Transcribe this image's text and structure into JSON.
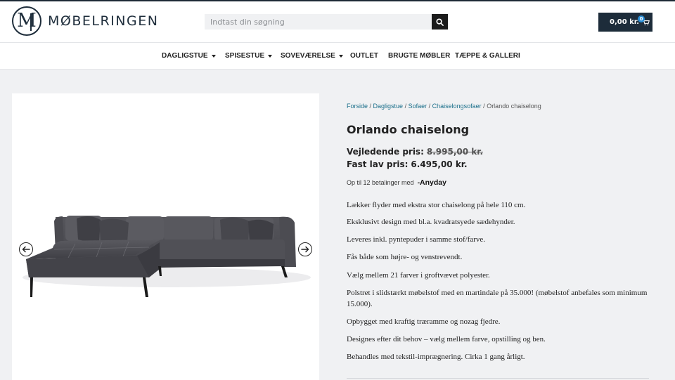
{
  "brand": {
    "name": "MØBELRINGEN",
    "mark": "M"
  },
  "search": {
    "placeholder": "Indtast din søgning"
  },
  "cart": {
    "total": "0,00 kr.",
    "count": "0"
  },
  "nav": [
    {
      "label": "DAGLIGSTUE",
      "dropdown": true
    },
    {
      "label": "SPISESTUE",
      "dropdown": true
    },
    {
      "label": "SOVEVÆRELSE",
      "dropdown": true
    },
    {
      "label": "OUTLET",
      "dropdown": false
    },
    {
      "label": "BRUGTE MØBLER",
      "dropdown": false
    },
    {
      "label": "TÆPPE & GALLERI",
      "dropdown": false
    }
  ],
  "breadcrumb": {
    "links": [
      "Forside",
      "Dagligstue",
      "Sofaer",
      "Chaiselongsofaer"
    ],
    "separator": " / ",
    "current": "Orlando chaiselong"
  },
  "product": {
    "title": "Orlando chaiselong",
    "rrp_label": "Vejledende pris:",
    "rrp_price": "8.995,00 kr.",
    "price_label": "Fast lav pris:",
    "price": "6.495,00 kr.",
    "installment_text": "Op til 12 betalinger med",
    "installment_brand": "-Anyday",
    "description": [
      "Lækker flyder med ekstra stor chaiselong på hele 110 cm.",
      "Eksklusivt design med bl.a. kvadratsyede sædehynder.",
      "Leveres inkl. pyntepuder i samme stof/farve.",
      "Fås både som højre- og venstrevendt.",
      "Vælg mellem 21 farver i groftvævet polyester.",
      "Polstret i slidstærkt møbelstof med en martindale på 35.000! (møbelstof anbefales som minimum 15.000).",
      "Opbygget med kraftig træramme og nozag fjedre.",
      "Designes efter dit behov – vælg mellem farve, opstilling og ben.",
      "Behandles med tekstil-imprægnering. Cirka 1 gang årligt."
    ]
  },
  "colors": {
    "navy": "#1d2c3a",
    "link": "#1a6f8a",
    "sofa": "#4a4a50",
    "bg": "#f0f1f3"
  },
  "icons": [
    "search-icon",
    "cart-icon",
    "chevron-left-icon",
    "chevron-right-icon",
    "caret-down-icon"
  ]
}
